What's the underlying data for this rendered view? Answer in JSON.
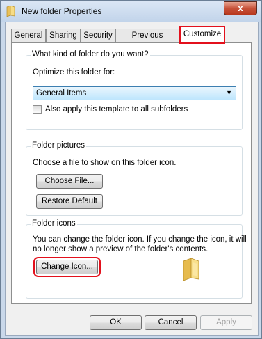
{
  "window": {
    "title": "New folder Properties",
    "close_label": "x"
  },
  "tabs": [
    {
      "label": "General"
    },
    {
      "label": "Sharing"
    },
    {
      "label": "Security"
    },
    {
      "label": "Previous Versions"
    },
    {
      "label": "Customize",
      "active": true
    }
  ],
  "folder_type": {
    "group_title": "What kind of folder do you want?",
    "optimize_label": "Optimize this folder for:",
    "selected_option": "General Items",
    "apply_checkbox_label": "Also apply this template to all subfolders",
    "apply_checked": false
  },
  "folder_pictures": {
    "group_title": "Folder pictures",
    "description": "Choose a file to show on this folder icon.",
    "choose_button": "Choose File...",
    "restore_button": "Restore Default"
  },
  "folder_icons": {
    "group_title": "Folder icons",
    "description_line1": "You can change the folder icon. If you change the icon, it will",
    "description_line2": "no longer show a preview of the folder's contents.",
    "change_button": "Change Icon..."
  },
  "footer": {
    "ok": "OK",
    "cancel": "Cancel",
    "apply": "Apply"
  }
}
